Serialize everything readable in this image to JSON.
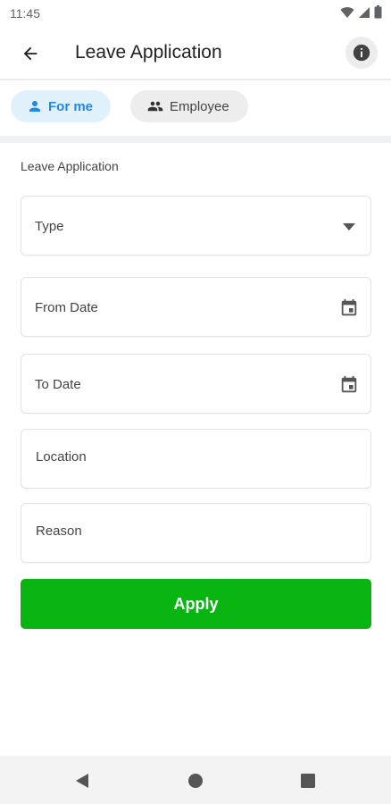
{
  "status_bar": {
    "time": "11:45",
    "icons": [
      "wifi-icon",
      "signal-icon",
      "battery-icon"
    ]
  },
  "app_bar": {
    "title": "Leave Application",
    "back_icon": "arrow-back-icon",
    "info_icon": "info-icon"
  },
  "tabs": [
    {
      "label": "For me",
      "icon": "person-icon",
      "selected": true
    },
    {
      "label": "Employee",
      "icon": "group-icon",
      "selected": false
    }
  ],
  "form": {
    "section_label": "Leave Application",
    "type_placeholder": "Type",
    "from_date_placeholder": "From Date",
    "to_date_placeholder": "To Date",
    "location_placeholder": "Location",
    "reason_placeholder": "Reason",
    "submit_label": "Apply"
  },
  "colors": {
    "accent_blue": "#1e88e5",
    "chip_selected_bg": "#e1f1fc",
    "apply_green": "#07b410"
  },
  "nav_bar": {
    "icons": [
      "nav-back-icon",
      "nav-home-icon",
      "nav-recents-icon"
    ]
  }
}
